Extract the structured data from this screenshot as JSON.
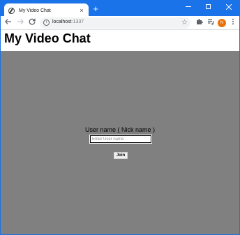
{
  "browser": {
    "tab_title": "My Video Chat",
    "tab_close": "×",
    "new_tab": "+",
    "url_host": "localhost",
    "url_port": ":1337",
    "profile_initial": "N"
  },
  "icons": {
    "back": "arrow-left-icon",
    "forward": "arrow-right-icon",
    "reload": "reload-icon",
    "info": "info-icon",
    "star": "star-icon",
    "extensions": "puzzle-icon",
    "media": "playlist-icon",
    "menu": "kebab-menu-icon"
  },
  "colors": {
    "titlebar": "#1a73e8",
    "page_background": "#808080",
    "avatar": "#e8710a"
  },
  "page": {
    "title": "My Video Chat",
    "user_label": "User name ( Nick name )",
    "user_input_placeholder": "Enter User name",
    "user_input_value": "",
    "join_label": "Join"
  }
}
